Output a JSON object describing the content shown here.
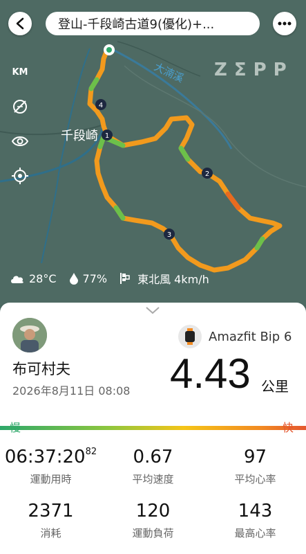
{
  "header": {
    "title": "登山-千段崎古道9(優化)+..."
  },
  "map": {
    "brand_watermark": "ZΣPP",
    "place_label": "千段崎",
    "river_label": "大湳溪",
    "side_buttons": [
      "KM",
      "layers-off-icon",
      "eye-icon",
      "locate-icon"
    ],
    "km_label": "KM",
    "markers": [
      "1",
      "2",
      "3",
      "4"
    ]
  },
  "weather": {
    "temperature": "28°C",
    "humidity": "77%",
    "wind": "東北風 4km/h"
  },
  "summary": {
    "user_name": "布可村夫",
    "datetime": "2026年8月11日 08:08",
    "device": "Amazfit Bip 6",
    "distance": "4.43",
    "distance_unit": "公里",
    "pace_slow": "慢",
    "pace_fast": "快"
  },
  "stats": [
    {
      "value": "06:37:20",
      "sup": "82",
      "label": "運動用時"
    },
    {
      "value": "0.67",
      "label": "平均速度"
    },
    {
      "value": "97",
      "label": "平均心率"
    },
    {
      "value": "2371",
      "label": "消耗"
    },
    {
      "value": "120",
      "label": "運動負荷"
    },
    {
      "value": "143",
      "label": "最高心率"
    }
  ],
  "colors": {
    "map_bg": "#4e6a63",
    "route_orange": "#f29a1d",
    "route_green": "#6cc04a",
    "pace_slow": "#2ea86a",
    "pace_fast": "#e4572e"
  }
}
